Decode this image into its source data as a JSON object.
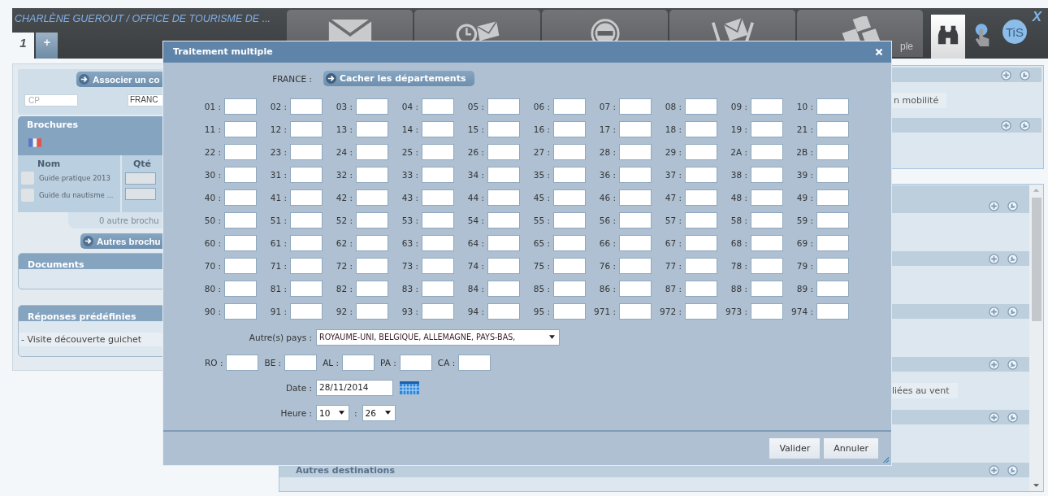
{
  "header": {
    "title": "CHARLÈNE GUEROUT / OFFICE DE TOURISME DE ...",
    "tabs": [
      {
        "label": "1",
        "selected": true
      },
      {
        "label": "+",
        "selected": false
      }
    ],
    "toolbar": [
      {
        "kind": "mail"
      },
      {
        "kind": "scheduled"
      },
      {
        "kind": "blocked"
      },
      {
        "kind": "sent"
      },
      {
        "kind": "bulk",
        "label": "ple"
      }
    ],
    "tools": [
      {
        "kind": "binoculars",
        "selected": true
      },
      {
        "kind": "pointer",
        "selected": false
      }
    ],
    "logo": "TiS",
    "close": "X"
  },
  "left_panel": {
    "contact": {
      "button": "Associer un co",
      "postcode_placeholder": "CP",
      "country": "FRANC"
    },
    "brochures": {
      "title": "Brochures",
      "columns": [
        "Nom",
        "Qté"
      ],
      "rows": [
        {
          "name": "Guide pratique 2013",
          "checked": false
        },
        {
          "name": "Guide du nautisme ...",
          "checked": false
        }
      ],
      "more": "0 autre brochu",
      "button": "Autres brochu"
    },
    "documents": {
      "title": "Documents"
    },
    "answers": {
      "title": "Réponses prédéfinies",
      "items": [
        "- Visite découverte guichet"
      ]
    }
  },
  "right_top": [
    {
      "kind": "note",
      "note": "n mobilité"
    },
    {
      "kind": "plain"
    }
  ],
  "right_bottom": [
    {
      "kind": "plain"
    },
    {
      "kind": "plain"
    },
    {
      "kind": "plain"
    },
    {
      "kind": "note",
      "note": "liées au vent"
    },
    {
      "kind": "plain"
    },
    {
      "kind": "title",
      "title": "Autres destinations"
    }
  ],
  "dialog": {
    "title": "Traitement multiple",
    "country_label": "FRANCE :",
    "toggle_button": "Cacher les départements",
    "departments": [
      [
        "01 :",
        "02 :",
        "03 :",
        "04 :",
        "05 :",
        "06 :",
        "07 :",
        "08 :",
        "09 :",
        "10 :"
      ],
      [
        "11 :",
        "12 :",
        "13 :",
        "14 :",
        "15 :",
        "16 :",
        "17 :",
        "18 :",
        "19 :",
        "21 :"
      ],
      [
        "22 :",
        "23 :",
        "24 :",
        "25 :",
        "26 :",
        "27 :",
        "28 :",
        "29 :",
        "2A :",
        "2B :"
      ],
      [
        "30 :",
        "31 :",
        "32 :",
        "33 :",
        "34 :",
        "35 :",
        "36 :",
        "37 :",
        "38 :",
        "39 :"
      ],
      [
        "40 :",
        "41 :",
        "42 :",
        "43 :",
        "44 :",
        "45 :",
        "46 :",
        "47 :",
        "48 :",
        "49 :"
      ],
      [
        "50 :",
        "51 :",
        "52 :",
        "53 :",
        "54 :",
        "55 :",
        "56 :",
        "57 :",
        "58 :",
        "59 :"
      ],
      [
        "60 :",
        "61 :",
        "62 :",
        "63 :",
        "64 :",
        "65 :",
        "66 :",
        "67 :",
        "68 :",
        "69 :"
      ],
      [
        "70 :",
        "71 :",
        "72 :",
        "73 :",
        "74 :",
        "75 :",
        "76 :",
        "77 :",
        "78 :",
        "79 :"
      ],
      [
        "80 :",
        "81 :",
        "82 :",
        "83 :",
        "84 :",
        "85 :",
        "86 :",
        "87 :",
        "88 :",
        "89 :"
      ],
      [
        "90 :",
        "91 :",
        "92 :",
        "93 :",
        "94 :",
        "95 :",
        "971 :",
        "972 :",
        "973 :",
        "974 :"
      ]
    ],
    "other_label": "Autre(s) pays :",
    "other_value": "ROYAUME-UNI, BELGIQUE, ALLEMAGNE, PAYS-BAS,",
    "other_codes": [
      "RO :",
      "BE :",
      "AL :",
      "PA :",
      "CA :"
    ],
    "date_label": "Date :",
    "date": "28/11/2014",
    "time_label": "Heure :",
    "hour": "10",
    "time_separator": ":",
    "minute": "26",
    "buttons": [
      "Valider",
      "Annuler"
    ]
  }
}
